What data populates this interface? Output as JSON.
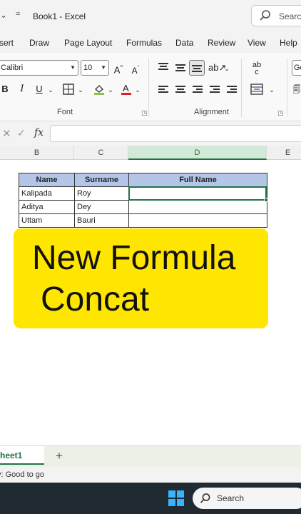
{
  "titlebar": {
    "more_glyph": "⌄",
    "customize_glyph": "=",
    "document_title": "Book1  -  Excel",
    "search_label": "Search"
  },
  "ribbon_tabs": [
    "sert",
    "Draw",
    "Page Layout",
    "Formulas",
    "Data",
    "Review",
    "View",
    "Help"
  ],
  "ribbon": {
    "font_name": "Calibri",
    "font_size": "10",
    "grow_font": "A^",
    "shrink_font": "Aˇ",
    "bold": "B",
    "italic": "I",
    "underline": "U",
    "font_group_label": "Font",
    "alignment_group_label": "Alignment",
    "wrap_label": "ab↓c",
    "general_label": "Ge"
  },
  "formula_bar": {
    "cancel_glyph": "✕",
    "enter_glyph": "✓",
    "fx_label": "fx",
    "value": ""
  },
  "columns": [
    "B",
    "C",
    "D",
    "E"
  ],
  "table": {
    "headers": [
      "Name",
      "Surname",
      "Full Name"
    ],
    "rows": [
      [
        "Kalipada",
        "Roy",
        ""
      ],
      [
        "Aditya",
        "Dey",
        ""
      ],
      [
        "Uttam",
        "Bauri",
        ""
      ]
    ]
  },
  "overlay": {
    "line1": "New Formula",
    "line2": "Concat",
    "color": "#ffe600"
  },
  "sheet_tabs": {
    "active": "heet1",
    "add_glyph": "+"
  },
  "status_bar": {
    "text": "y: Good to go"
  },
  "taskbar": {
    "search_label": "Search"
  },
  "colors": {
    "excel_green": "#217346",
    "header_blue": "#b4c6e7",
    "taskbar": "#1f2a33"
  }
}
